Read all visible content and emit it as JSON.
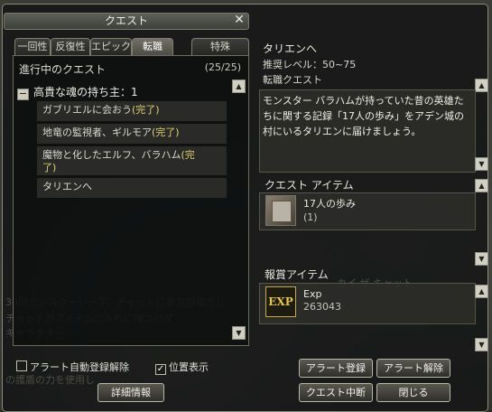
{
  "window": {
    "title": "クエスト",
    "close_glyph": "✕"
  },
  "tabs": [
    {
      "label": "一回性"
    },
    {
      "label": "反復性"
    },
    {
      "label": "エピック"
    },
    {
      "label": "転職"
    },
    {
      "label": "特殊"
    }
  ],
  "quest_list": {
    "header": "進行中のクエスト",
    "count": "(25/25)",
    "group_title": "高貴な魂の持ち主：1",
    "items": [
      {
        "text": "ガブリエルに会おう",
        "status": "(完了)"
      },
      {
        "text": "地竜の監視者、ギルモア",
        "status": "(完了)"
      },
      {
        "text": "魔物と化したエルフ、バラハム",
        "status": "(完了)"
      },
      {
        "text": "タリエンへ",
        "status": ""
      }
    ]
  },
  "options": {
    "alert_auto_label": "アラート自動登録解除",
    "alert_auto_checked": false,
    "show_position_label": "位置表示",
    "show_position_checked": true,
    "check_glyph": "✓"
  },
  "buttons": {
    "details": "詳細情報",
    "alert_register": "アラート登録",
    "alert_cancel": "アラート解除",
    "quest_abort": "クエスト中断",
    "close": "閉じる"
  },
  "detail": {
    "title": "タリエンへ",
    "level": "推奨レベル：50~75",
    "type": "転職クエスト",
    "description": "モンスター バラハムが持っていた昔の英雄たちに関する記録「17人の歩み」をアデン城の村にいるタリエンに届けましょう。"
  },
  "quest_item": {
    "section": "クエスト アイテム",
    "name": "17人の歩み",
    "qty": "(1)"
  },
  "reward": {
    "section": "報賞アイテム",
    "icon_text": "EXP",
    "name": "Exp",
    "amount": "263043"
  },
  "scroll": {
    "up": "▲",
    "down": "▼"
  },
  "colors": {
    "complete": "#e2d070",
    "text": "#d8d8d0"
  }
}
